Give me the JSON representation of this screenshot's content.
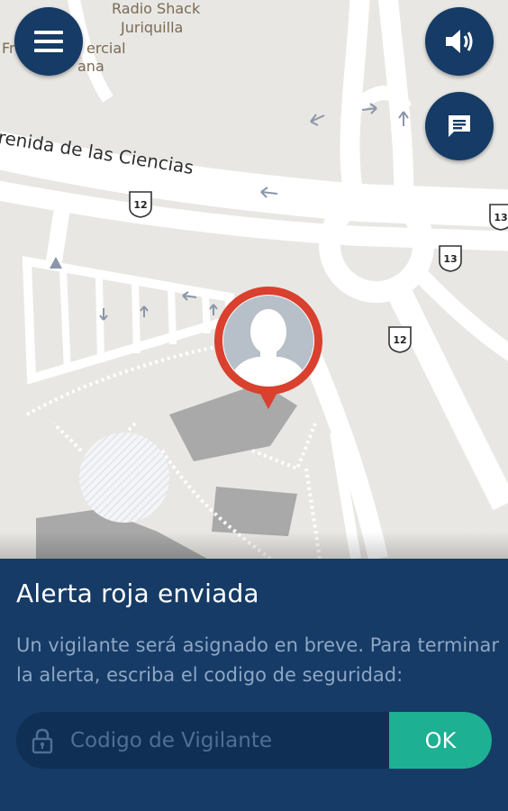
{
  "map": {
    "labels": [
      "Radio Shack",
      "Juriquilla",
      "Fr",
      "ercial",
      "ana"
    ],
    "street_name": "renida de las Ciencias",
    "route_shields": [
      "12",
      "13",
      "13",
      "12"
    ]
  },
  "controls": {
    "menu_icon": "hamburger-menu-icon",
    "sound_icon": "speaker-icon",
    "chat_icon": "chat-bubble-icon"
  },
  "marker": {
    "icon": "user-avatar-placeholder-icon",
    "ring_color": "#d9402e"
  },
  "alert": {
    "title": "Alerta roja enviada",
    "message": "Un vigilante será asignado en breve. Para terminar la alerta, escriba el codigo de seguridad:",
    "code_placeholder": "Codigo de Vigilante",
    "ok_label": "OK"
  },
  "colors": {
    "navy": "#153b66",
    "accent_green": "#1db093",
    "alert_red": "#d9402e"
  }
}
